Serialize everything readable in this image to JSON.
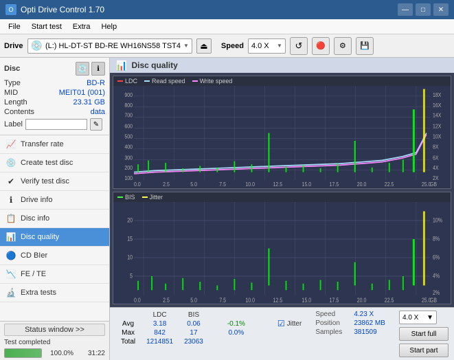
{
  "titleBar": {
    "title": "Opti Drive Control 1.70",
    "minimize": "—",
    "maximize": "□",
    "close": "✕"
  },
  "menuBar": {
    "items": [
      "File",
      "Start test",
      "Extra",
      "Help"
    ]
  },
  "toolbar": {
    "driveLabel": "Drive",
    "driveName": "(L:)  HL-DT-ST BD-RE  WH16NS58 TST4",
    "speedLabel": "Speed",
    "speedValue": "4.0 X"
  },
  "disc": {
    "title": "Disc",
    "typeLabel": "Type",
    "typeValue": "BD-R",
    "midLabel": "MID",
    "midValue": "MEIT01 (001)",
    "lengthLabel": "Length",
    "lengthValue": "23.31 GB",
    "contentsLabel": "Contents",
    "contentsValue": "data",
    "labelLabel": "Label",
    "labelValue": ""
  },
  "navItems": [
    {
      "id": "transfer-rate",
      "label": "Transfer rate",
      "icon": "📈"
    },
    {
      "id": "create-test-disc",
      "label": "Create test disc",
      "icon": "💿"
    },
    {
      "id": "verify-test-disc",
      "label": "Verify test disc",
      "icon": "✔"
    },
    {
      "id": "drive-info",
      "label": "Drive info",
      "icon": "ℹ"
    },
    {
      "id": "disc-info",
      "label": "Disc info",
      "icon": "📋"
    },
    {
      "id": "disc-quality",
      "label": "Disc quality",
      "icon": "📊",
      "active": true
    },
    {
      "id": "cd-bier",
      "label": "CD BIer",
      "icon": "🔵"
    },
    {
      "id": "fe-te",
      "label": "FE / TE",
      "icon": "📉"
    },
    {
      "id": "extra-tests",
      "label": "Extra tests",
      "icon": "🔬"
    }
  ],
  "statusBar": {
    "windowBtn": "Status window >>",
    "progressValue": 100,
    "progressText": "100.0%",
    "timeText": "31:22",
    "statusText": "Test completed"
  },
  "chartHeader": {
    "title": "Disc quality"
  },
  "chart1": {
    "legend": [
      "LDC",
      "Read speed",
      "Write speed"
    ],
    "legendColors": [
      "#ff4444",
      "#aaddff",
      "#ff88ff"
    ],
    "yAxisRight": [
      "18X",
      "16X",
      "14X",
      "12X",
      "10X",
      "8X",
      "6X",
      "4X",
      "2X"
    ],
    "yAxisLeft": [
      "900",
      "800",
      "700",
      "600",
      "500",
      "400",
      "300",
      "200",
      "100"
    ],
    "xAxis": [
      "0.0",
      "2.5",
      "5.0",
      "7.5",
      "10.0",
      "12.5",
      "15.0",
      "17.5",
      "20.0",
      "22.5",
      "25.0"
    ],
    "gbUnit": "GB"
  },
  "chart2": {
    "legend": [
      "BIS",
      "Jitter"
    ],
    "legendColors": [
      "#44ff44",
      "#ffff44"
    ],
    "yAxisRight": [
      "10%",
      "8%",
      "6%",
      "4%",
      "2%"
    ],
    "yAxisLeft": [
      "20",
      "15",
      "10",
      "5"
    ],
    "xAxis": [
      "0.0",
      "2.5",
      "5.0",
      "7.5",
      "10.0",
      "12.5",
      "15.0",
      "17.5",
      "20.0",
      "22.5",
      "25.0"
    ],
    "gbUnit": "GB"
  },
  "stats": {
    "headers": [
      "LDC",
      "BIS",
      "",
      "Jitter",
      "Speed",
      ""
    ],
    "avgLabel": "Avg",
    "avgLDC": "3.18",
    "avgBIS": "0.06",
    "avgJitter": "-0.1%",
    "maxLabel": "Max",
    "maxLDC": "842",
    "maxBIS": "17",
    "maxJitter": "0.0%",
    "totalLabel": "Total",
    "totalLDC": "1214851",
    "totalBIS": "23063",
    "speedLabel": "Speed",
    "speedValue": "4.23 X",
    "positionLabel": "Position",
    "positionValue": "23862 MB",
    "samplesLabel": "Samples",
    "samplesValue": "381509",
    "speedDropdown": "4.0 X",
    "startFull": "Start full",
    "startPart": "Start part"
  }
}
